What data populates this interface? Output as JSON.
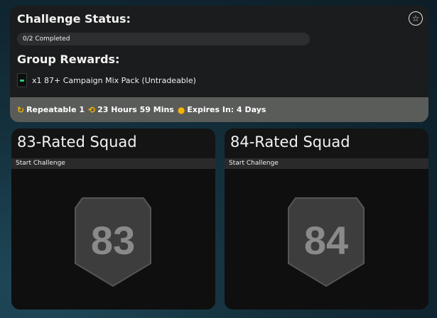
{
  "status": {
    "title": "Challenge Status:",
    "progress_label": "0/2 Completed",
    "progress": 0,
    "rewards_title": "Group Rewards:",
    "reward_text": "x1 87+ Campaign Mix Pack (Untradeable)",
    "star_icon": "star-outline-icon",
    "footer": {
      "repeatable": "Repeatable 1",
      "time_left": "23 Hours 59 Mins",
      "expires": "Expires In: 4 Days"
    }
  },
  "cards": [
    {
      "title": "83-Rated Squad",
      "action": "Start Challenge",
      "badge": "83"
    },
    {
      "title": "84-Rated Squad",
      "action": "Start Challenge",
      "badge": "84"
    }
  ],
  "colors": {
    "panel": "#1b1c1d",
    "footer": "#5a5c5a",
    "accent_gold": "#f5b400",
    "badge_fill": "#3d3d3d",
    "badge_text": "#8a8a8a"
  }
}
